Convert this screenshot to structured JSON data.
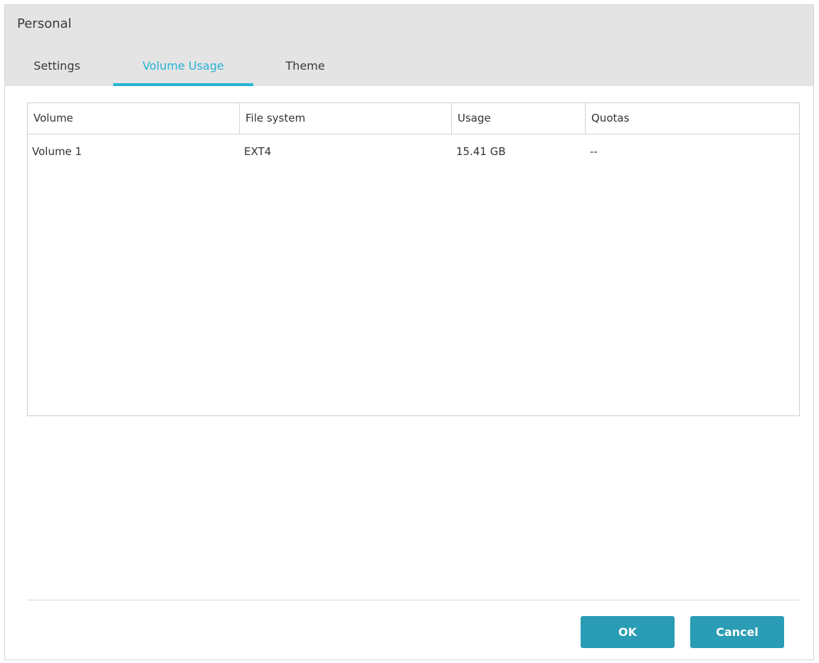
{
  "window": {
    "title": "Personal"
  },
  "tabs": [
    {
      "label": "Settings",
      "active": false
    },
    {
      "label": "Volume Usage",
      "active": true
    },
    {
      "label": "Theme",
      "active": false
    }
  ],
  "table": {
    "columns": [
      "Volume",
      "File system",
      "Usage",
      "Quotas"
    ],
    "rows": [
      [
        "Volume 1",
        "EXT4",
        "15.41 GB",
        "--"
      ]
    ]
  },
  "buttons": {
    "ok_label": "OK",
    "cancel_label": "Cancel"
  },
  "colors": {
    "accent": "#25b4d6",
    "button": "#2a9cb5",
    "header_bg": "#e4e4e4"
  }
}
